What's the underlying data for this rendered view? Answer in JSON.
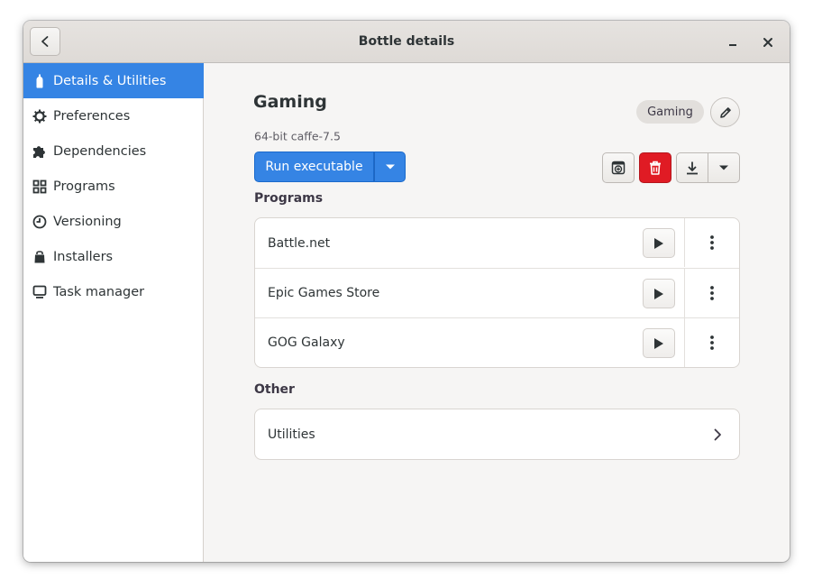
{
  "window": {
    "title": "Bottle details",
    "back_icon": "back-arrow-icon",
    "minimize_icon": "minimize-icon",
    "close_icon": "close-icon"
  },
  "sidebar": {
    "items": [
      {
        "label": "Details & Utilities",
        "icon": "bottle-icon",
        "active": true
      },
      {
        "label": "Preferences",
        "icon": "gear-icon",
        "active": false
      },
      {
        "label": "Dependencies",
        "icon": "puzzle-icon",
        "active": false
      },
      {
        "label": "Programs",
        "icon": "grid-icon",
        "active": false
      },
      {
        "label": "Versioning",
        "icon": "clock-icon",
        "active": false
      },
      {
        "label": "Installers",
        "icon": "bag-icon",
        "active": false
      },
      {
        "label": "Task manager",
        "icon": "monitor-icon",
        "active": false
      }
    ]
  },
  "bottle": {
    "name": "Gaming",
    "subtitle": "64-bit caffe-7.5",
    "environment_badge": "Gaming"
  },
  "actions": {
    "run_label": "Run executable",
    "tools": [
      "wine-icon",
      "trash-icon",
      "download-icon",
      "chevron-down-icon"
    ]
  },
  "programs": {
    "title": "Programs",
    "rows": [
      {
        "name": "Battle.net"
      },
      {
        "name": "Epic Games Store"
      },
      {
        "name": "GOG Galaxy"
      }
    ]
  },
  "other": {
    "title": "Other",
    "rows": [
      {
        "name": "Utilities"
      }
    ]
  },
  "colors": {
    "accent": "#3584e4",
    "destructive": "#e01b24",
    "sidebar_bg": "#ffffff",
    "content_bg": "#f6f5f4"
  }
}
